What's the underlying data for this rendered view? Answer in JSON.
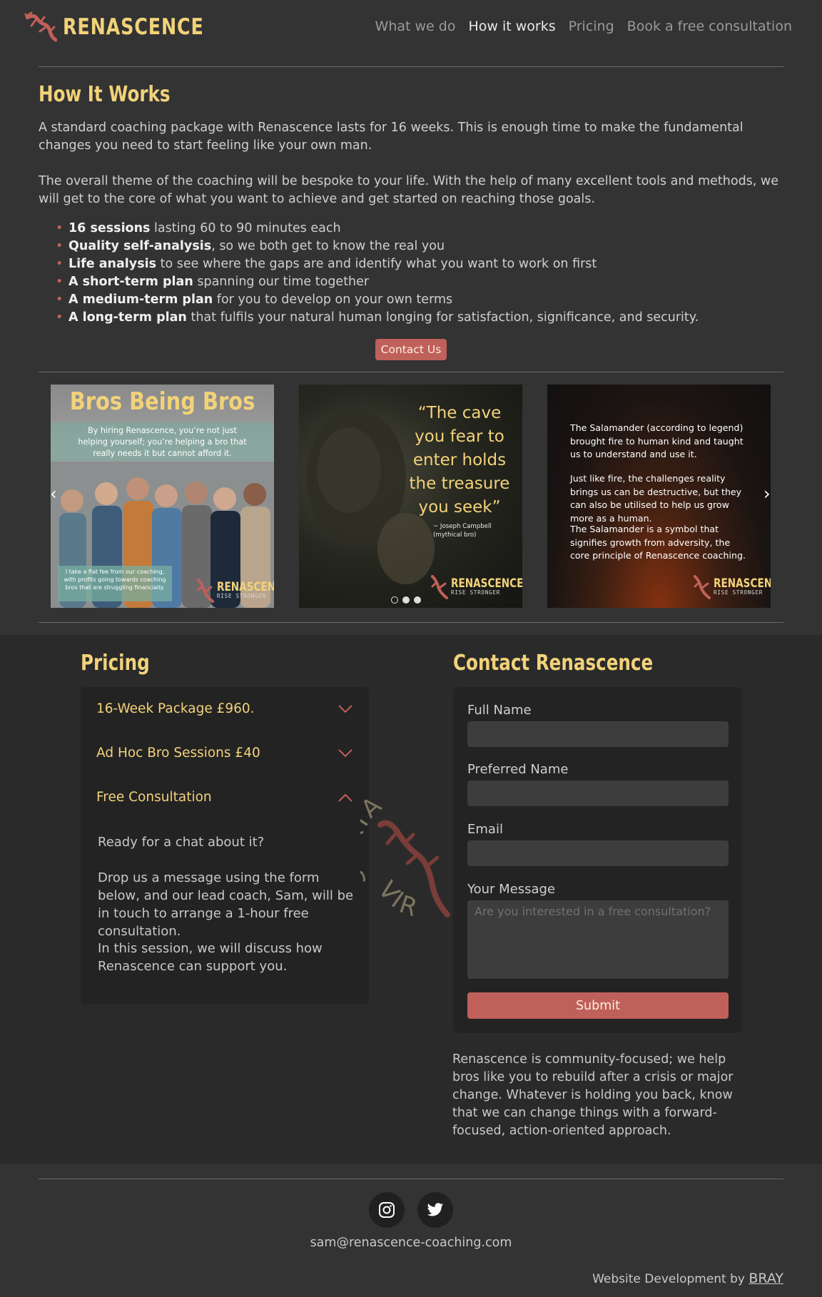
{
  "brand": {
    "name": "RENASCENCE"
  },
  "nav": {
    "items": [
      {
        "label": "What we do"
      },
      {
        "label": "How it works"
      },
      {
        "label": "Pricing"
      },
      {
        "label": "Book a free consultation"
      }
    ],
    "active": "How it works"
  },
  "how": {
    "title": "How It Works",
    "para1": "A standard coaching package with Renascence lasts for 16 weeks. This is enough time to make the fundamental changes you need to start feeling like your own man.",
    "para2": "The overall theme of the coaching will be bespoke to your life. With the help of many excellent tools and methods, we will get to the core of what you want to achieve and get started on reaching those goals.",
    "features": [
      {
        "strong": "16 sessions",
        "rest": " lasting 60 to 90 minutes each"
      },
      {
        "strong": "Quality self-analysis",
        "rest": ", so we both get to know the real you"
      },
      {
        "strong": "Life analysis",
        "rest": " to see where the gaps are and identify what you want to work on first"
      },
      {
        "strong": "A short-term plan",
        "rest": " spanning our time together"
      },
      {
        "strong": "A medium-term plan",
        "rest": " for you to develop on your own terms"
      },
      {
        "strong": "A long-term plan",
        "rest": " that fulfils your natural human longing for satisfaction, significance, and security."
      }
    ],
    "cta": "Contact Us"
  },
  "carousel": {
    "slide1": {
      "title": "Bros Being Bros",
      "band": "By hiring Renascence, you’re not just helping yourself; you’re helping a bro that really needs it but cannot afford it.",
      "foot": "I take a flat fee from our coaching, with profits going towards coaching bros that are struggling financially."
    },
    "slide2": {
      "quote": "“The cave you fear to enter holds the treasure you seek”",
      "attr1": "~ Joseph Campbell",
      "attr2": "(mythical bro)"
    },
    "slide3": {
      "p1": "The Salamander (according to legend) brought fire to human kind and taught us to understand and use it.",
      "p2": "Just like fire, the challenges reality brings us can be destructive, but they can also be utilised to help us grow more as a human.",
      "p3": "The Salamander is a symbol that signifies growth from adversity, the core principle of Renascence coaching."
    },
    "brand_word": "RENASCENCE",
    "brand_sub": "RISE STRONGER",
    "prev_icon": "‹",
    "next_icon": "›",
    "active_slide": 2
  },
  "pricing": {
    "title": "Pricing",
    "items": [
      {
        "label": "16-Week Package £960.",
        "open": false
      },
      {
        "label": "Ad Hoc Bro Sessions £40",
        "open": false
      },
      {
        "label": "Free Consultation",
        "open": true
      }
    ],
    "open_body": [
      "Ready for a chat about it?",
      "Drop us a message using the form below, and our lead coach, Sam, will be in touch to arrange a 1-hour free consultation.",
      "In this session, we will discuss how Renascence can support you."
    ]
  },
  "seal": {
    "top_text": "SERIA",
    "bottom_text": "VIR"
  },
  "contact": {
    "title": "Contact Renascence",
    "fields": {
      "full_name": {
        "label": "Full Name",
        "value": ""
      },
      "preferred_name": {
        "label": "Preferred Name",
        "value": ""
      },
      "email": {
        "label": "Email",
        "value": ""
      },
      "message": {
        "label": "Your Message",
        "placeholder": "Are you interested in a free consultation?"
      }
    },
    "submit": "Submit",
    "community": "Renascence is community-focused; we help bros like you to rebuild after a crisis or major change. Whatever is holding you back, know that we can change things with a forward-focused, action-oriented approach."
  },
  "footer": {
    "email": "sam@renascence-coaching.com",
    "credit_prefix": "Website Development by",
    "credit_link": "BRAY"
  },
  "colors": {
    "accent": "#f2d27a",
    "button": "#c0605a",
    "background": "#333333",
    "section_bg": "#2a2a2a",
    "panel_bg": "#232323"
  },
  "icons": [
    "salamander-logo-icon",
    "chevron-down-icon",
    "chevron-up-icon",
    "chevron-left-icon",
    "chevron-right-icon",
    "instagram-icon",
    "twitter-icon"
  ]
}
